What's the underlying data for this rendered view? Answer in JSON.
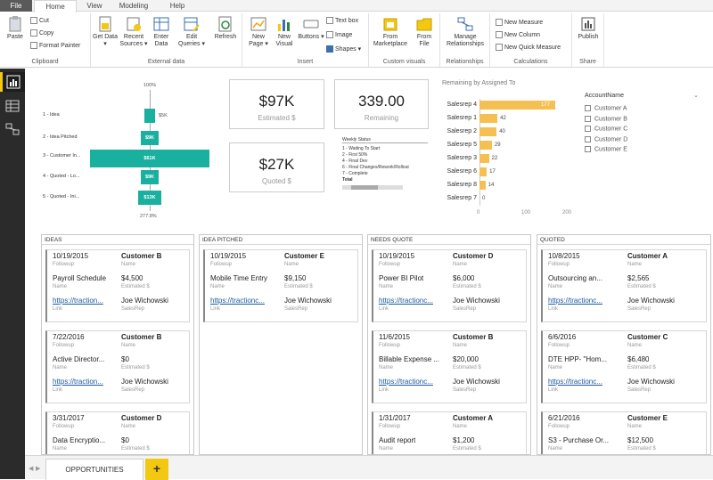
{
  "menu": {
    "file": "File",
    "home": "Home",
    "view": "View",
    "modeling": "Modeling",
    "help": "Help"
  },
  "ribbon": {
    "clipboard": {
      "paste": "Paste",
      "cut": "Cut",
      "copy": "Copy",
      "format_painter": "Format Painter",
      "group": "Clipboard"
    },
    "external": {
      "get_data": "Get Data ▾",
      "recent": "Recent Sources ▾",
      "enter": "Enter Data",
      "edit": "Edit Queries ▾",
      "refresh": "Refresh",
      "group": "External data"
    },
    "insert": {
      "new_page": "New Page ▾",
      "new_visual": "New Visual",
      "buttons": "Buttons ▾",
      "text_box": "Text box",
      "image": "Image",
      "shapes": "Shapes ▾",
      "group": "Insert"
    },
    "custom": {
      "from_marketplace": "From Marketplace",
      "from_file": "From File",
      "group": "Custom visuals"
    },
    "relationships": {
      "manage": "Manage Relationships",
      "group": "Relationships"
    },
    "calculations": {
      "new_measure": "New Measure",
      "new_column": "New Column",
      "new_quick": "New Quick Measure",
      "group": "Calculations"
    },
    "share": {
      "publish": "Publish",
      "group": "Share"
    }
  },
  "funnel": {
    "top_pct": "100%",
    "bottom_pct": "277.8%",
    "stages": [
      {
        "label": "1 - Idea",
        "value": "$5K",
        "width": 0.08
      },
      {
        "label": "2 - Idea Pitched",
        "value": "$9K",
        "width": 0.15
      },
      {
        "label": "3 - Customer In...",
        "value": "$61K",
        "width": 1.0
      },
      {
        "label": "4 - Quoted - Lo...",
        "value": "$9K",
        "width": 0.15
      },
      {
        "label": "5 - Quoted - Ini...",
        "value": "$13K",
        "width": 0.2
      }
    ]
  },
  "kpis": {
    "estimated": {
      "value": "$97K",
      "label": "Estimated $"
    },
    "remaining": {
      "value": "339.00",
      "label": "Remaining"
    },
    "quoted": {
      "value": "$27K",
      "label": "Quoted $"
    }
  },
  "weekly_status": {
    "header": "Weekly Status",
    "rows": [
      "1 - Waiting To Start",
      "2 - First 50%",
      "4 - Final Dev",
      "6 - Final Changes/Rework/Rollout",
      "7 - Complete",
      "Total"
    ]
  },
  "chart_data": {
    "type": "bar",
    "title": "Remaining by Assigned To",
    "categories": [
      "Salesrep 4",
      "Salesrep 1",
      "Salesrep 2",
      "Salesrep 5",
      "Salesrep 3",
      "Salesrep 6",
      "Salesrep 8",
      "Salesrep 7"
    ],
    "values": [
      177,
      42,
      40,
      29,
      22,
      17,
      14,
      0
    ],
    "xlim": [
      0,
      200
    ],
    "xticks": [
      "0",
      "100",
      "200"
    ],
    "color": "#f6bf52"
  },
  "slicer": {
    "title": "AccountName",
    "items": [
      "Customer A",
      "Customer B",
      "Customer C",
      "Customer D",
      "Customer E"
    ]
  },
  "kanban": {
    "labels": {
      "followup": "Followup",
      "name": "Name",
      "estimated": "Estimated $",
      "link": "Link",
      "salesrep": "SalesRep"
    },
    "columns": [
      {
        "title": "IDEAS",
        "cards": [
          {
            "date": "10/19/2015",
            "customer": "Customer B",
            "desc": "Payroll Schedule",
            "amount": "$4,500",
            "link": "https://traction...",
            "rep": "Joe Wichowski"
          },
          {
            "date": "7/22/2016",
            "customer": "Customer B",
            "desc": "Active Director...",
            "amount": "$0",
            "link": "https://traction...",
            "rep": "Joe Wichowski"
          },
          {
            "date": "3/31/2017",
            "customer": "Customer D",
            "desc": "Data Encryptio...",
            "amount": "$0",
            "link": "",
            "rep": ""
          }
        ]
      },
      {
        "title": "IDEA PITCHED",
        "cards": [
          {
            "date": "10/19/2015",
            "customer": "Customer E",
            "desc": "Mobile Time Entry",
            "amount": "$9,150",
            "link": "https://tractionc...",
            "rep": "Joe Wichowski"
          }
        ]
      },
      {
        "title": "NEEDS QUOTE",
        "cards": [
          {
            "date": "10/19/2015",
            "customer": "Customer D",
            "desc": "Power BI Pilot",
            "amount": "$6,000",
            "link": "https://tractionc...",
            "rep": "Joe Wichowski"
          },
          {
            "date": "11/6/2015",
            "customer": "Customer B",
            "desc": "Billable Expense ...",
            "amount": "$20,000",
            "link": "https://tractionc...",
            "rep": "Joe Wichowski"
          },
          {
            "date": "1/31/2017",
            "customer": "Customer A",
            "desc": "Audit report",
            "amount": "$1,200",
            "link": "",
            "rep": ""
          }
        ]
      },
      {
        "title": "QUOTED",
        "cards": [
          {
            "date": "10/8/2015",
            "customer": "Customer A",
            "desc": "Outsourcing an...",
            "amount": "$2,565",
            "link": "https://tractionc...",
            "rep": "Joe Wichowski"
          },
          {
            "date": "6/6/2016",
            "customer": "Customer C",
            "desc": "DTE HPP- \"Hom...",
            "amount": "$6,480",
            "link": "https://tractionc...",
            "rep": "Joe Wichowski"
          },
          {
            "date": "6/21/2016",
            "customer": "Customer E",
            "desc": "S3 - Purchase Or...",
            "amount": "$12,500",
            "link": "",
            "rep": ""
          }
        ]
      }
    ]
  },
  "pages": {
    "tab": "OPPORTUNITIES",
    "add": "+"
  }
}
